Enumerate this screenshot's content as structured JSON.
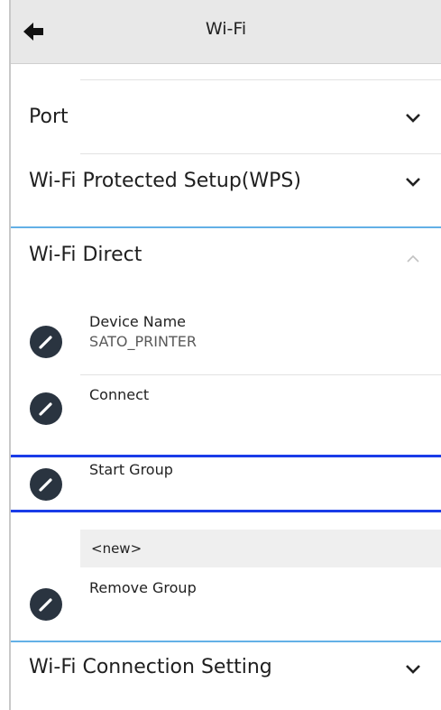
{
  "header": {
    "title": "Wi-Fi",
    "back_icon": "back-arrow-icon"
  },
  "sections": {
    "port": {
      "label": "Port",
      "state_icon": "chevron-down-icon"
    },
    "wps": {
      "label": "Wi-Fi Protected Setup(WPS)",
      "state_icon": "chevron-down-icon"
    },
    "wifi_direct": {
      "label": "Wi-Fi Direct",
      "state_icon": "chevron-up-icon",
      "items": {
        "device_name": {
          "label": "Device Name",
          "value": "SATO_PRINTER"
        },
        "connect": {
          "label": "Connect"
        },
        "start_group": {
          "label": "Start Group"
        },
        "group_entry": {
          "label": "<new>"
        },
        "remove_group": {
          "label": "Remove Group"
        }
      }
    },
    "connection_setting": {
      "label": "Wi-Fi Connection Setting",
      "state_icon": "chevron-down-icon"
    }
  },
  "colors": {
    "header_bg": "#e8e8e8",
    "accent_divider": "#63b0e6",
    "highlight_border": "#1a3ce8",
    "edit_button": "#2a3440"
  }
}
